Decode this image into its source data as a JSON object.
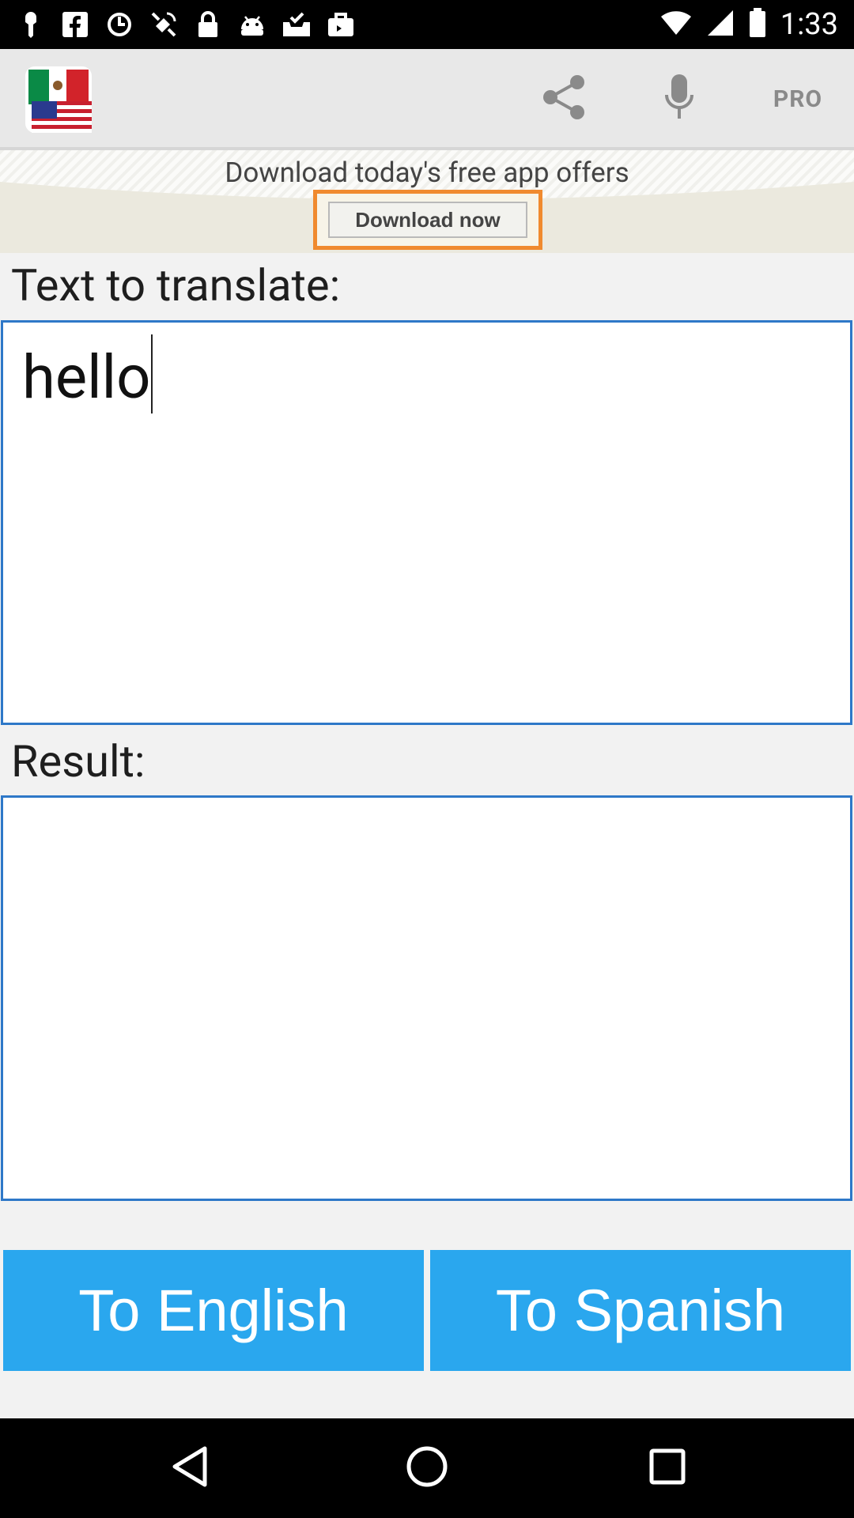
{
  "status_bar": {
    "time": "1:33",
    "icons": [
      "notification-icon",
      "facebook-icon",
      "sync-icon",
      "gps-icon",
      "lock-icon",
      "android-icon",
      "download-done-icon",
      "briefcase-icon",
      "wifi-icon",
      "signal-icon",
      "battery-icon"
    ]
  },
  "action_bar": {
    "app_icon": "mexico-usa-flags-icon",
    "share_icon": "share-icon",
    "mic_icon": "microphone-icon",
    "pro_label": "PRO"
  },
  "ad": {
    "headline": "Download today's free app offers",
    "button_label": "Download now"
  },
  "input": {
    "label": "Text to translate:",
    "value": "hello"
  },
  "result": {
    "label": "Result:",
    "value": ""
  },
  "buttons": {
    "to_english": "To English",
    "to_spanish": "To Spanish"
  },
  "colors": {
    "accent_blue": "#2aa7ee",
    "input_border": "#2e78c8",
    "ad_highlight": "#f08a2e"
  }
}
